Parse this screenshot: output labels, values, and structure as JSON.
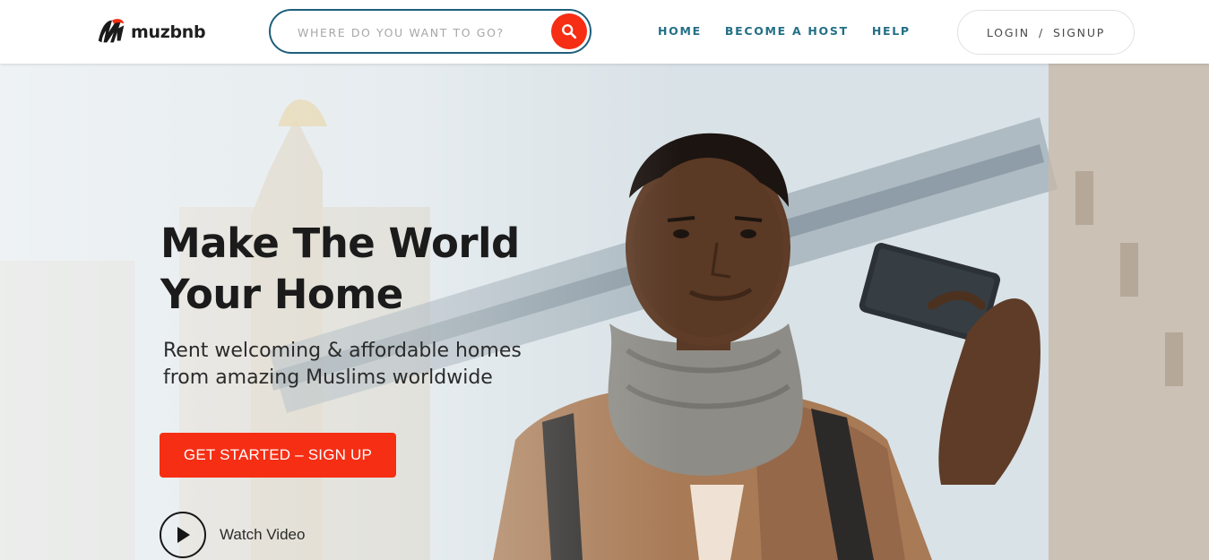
{
  "brand": {
    "name": "muzbnb",
    "accent": "#f52e14",
    "nav_color": "#236f86"
  },
  "search": {
    "placeholder": "WHERE DO YOU WANT TO GO?",
    "value": "",
    "icon": "search-icon"
  },
  "nav": {
    "items": [
      "HOME",
      "BECOME A HOST",
      "HELP"
    ]
  },
  "auth": {
    "login": "LOGIN",
    "separator": "/",
    "signup": "SIGNUP"
  },
  "hero": {
    "headline_line1": "Make The World",
    "headline_line2": "Your Home",
    "subtitle_line1": "Rent welcoming & affordable homes",
    "subtitle_line2": "from amazing Muslims worldwide",
    "cta_label": "GET STARTED – SIGN UP",
    "watch_label": "Watch Video",
    "watch_icon": "play-icon"
  }
}
